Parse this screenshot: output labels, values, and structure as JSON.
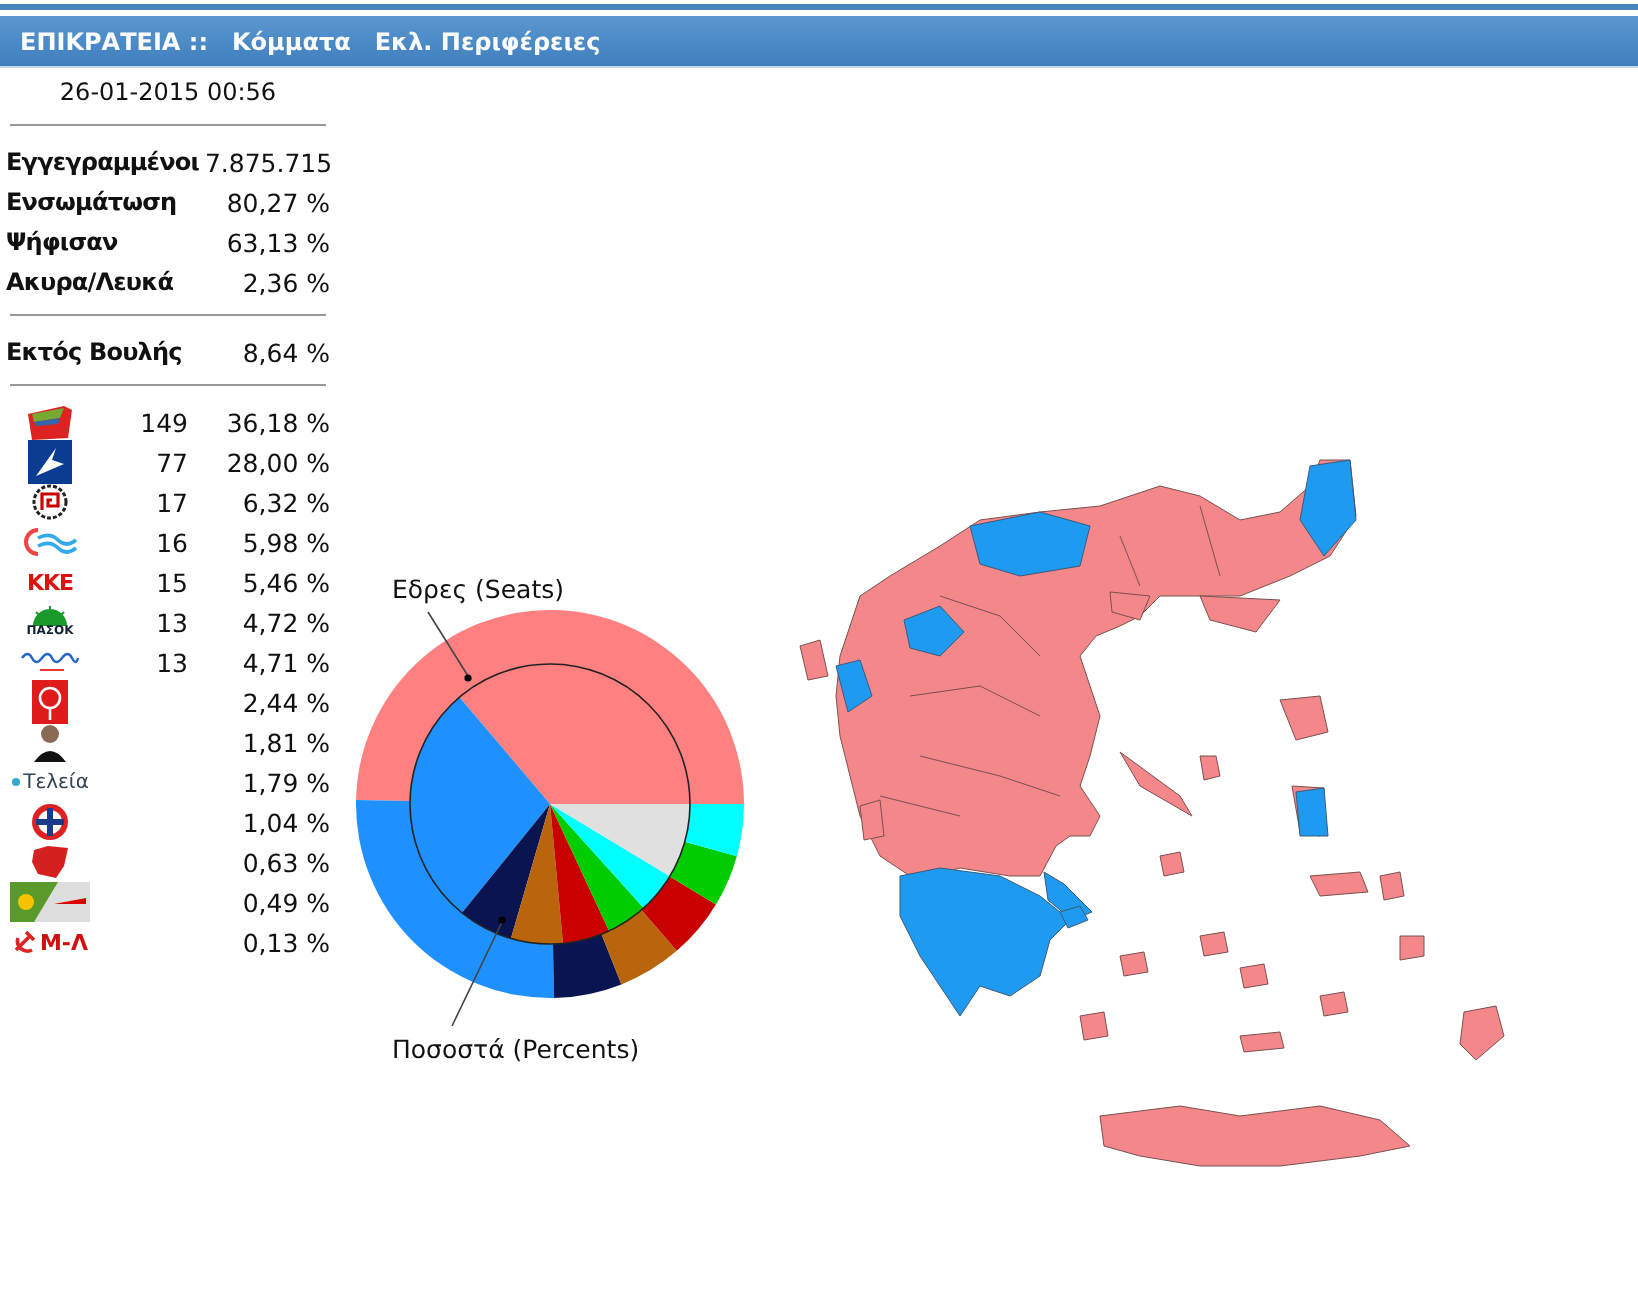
{
  "nav": [
    {
      "label": "ΕΠΙΚΡΑΤΕΙΑ ::"
    },
    {
      "label": "Κόμματα"
    },
    {
      "label": "Εκλ. Περιφέρειες"
    }
  ],
  "timestamp": "26-01-2015 00:56",
  "stats": [
    {
      "label": "Εγγεγραμμένοι",
      "value": "7.875.715"
    },
    {
      "label": "Ενσωμάτωση",
      "value": "80,27 %"
    },
    {
      "label": "Ψήφισαν",
      "value": "63,13 %"
    },
    {
      "label": "Ακυρα/Λευκά",
      "value": "2,36 %"
    }
  ],
  "outside": {
    "label": "Εκτός Βουλής",
    "value": "8,64 %"
  },
  "parties": [
    {
      "logo": {
        "kind": "flag"
      },
      "seats": "149",
      "percent": "36,18 %"
    },
    {
      "logo": {
        "kind": "nd"
      },
      "seats": "77",
      "percent": "28,00 %"
    },
    {
      "logo": {
        "kind": "meander"
      },
      "seats": "17",
      "percent": "6,32 %"
    },
    {
      "logo": {
        "kind": "waves"
      },
      "seats": "16",
      "percent": "5,98 %"
    },
    {
      "logo": {
        "kind": "text",
        "text": "ΚΚΕ"
      },
      "seats": "15",
      "percent": "5,46 %"
    },
    {
      "logo": {
        "kind": "sun",
        "text": "ΠΑΣΟΚ"
      },
      "seats": "13",
      "percent": "4,72 %"
    },
    {
      "logo": {
        "kind": "script"
      },
      "seats": "13",
      "percent": "4,71 %"
    },
    {
      "logo": {
        "kind": "rose"
      },
      "percent": "2,44 %"
    },
    {
      "logo": {
        "kind": "person"
      },
      "percent": "1,81 %"
    },
    {
      "logo": {
        "kind": "dot",
        "text": "Τελεία"
      },
      "percent": "1,79 %"
    },
    {
      "logo": {
        "kind": "cross"
      },
      "percent": "1,04 %"
    },
    {
      "logo": {
        "kind": "shape"
      },
      "percent": "0,63 %"
    },
    {
      "logo": {
        "kind": "split"
      },
      "percent": "0,49 %"
    },
    {
      "logo": {
        "kind": "hammer",
        "text": "Μ-Λ"
      },
      "percent": "0,13 %"
    }
  ],
  "pie": {
    "outer_label": "Εδρες (Seats)",
    "inner_label": "Ποσοστά (Percents)",
    "slices": [
      {
        "color": "#ff8080"
      },
      {
        "color": "#1e90ff"
      },
      {
        "color": "#0a1450"
      },
      {
        "color": "#b8650c"
      },
      {
        "color": "#c80000"
      },
      {
        "color": "#00cc00"
      },
      {
        "color": "#00ffff"
      }
    ]
  }
}
